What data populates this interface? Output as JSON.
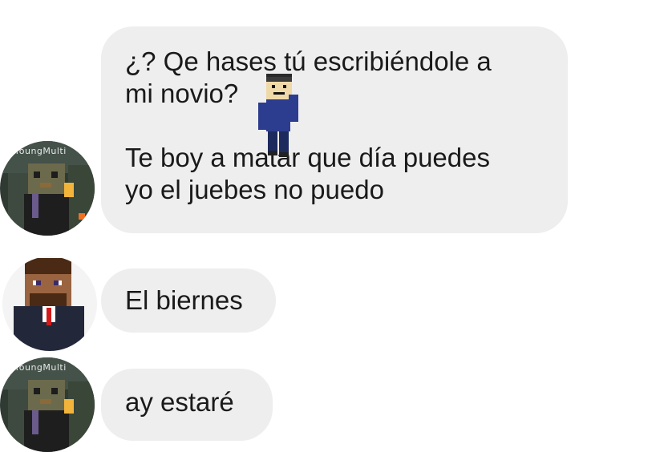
{
  "messages": [
    {
      "sender": "other",
      "lines_a": [
        "¿? Qe hases tú escribiéndole a",
        "mi novio?"
      ],
      "lines_b": [
        "Te boy a matar que día puedes",
        "yo el juebes no puedo"
      ],
      "sticker": "minecraft-character-sticker"
    },
    {
      "sender": "me",
      "text": "El biernes"
    },
    {
      "sender": "other",
      "text": "ay estaré"
    }
  ],
  "avatars": {
    "other": {
      "caption": "YoungMulti",
      "icon": "minecraft-skin-avatar"
    },
    "me": {
      "icon": "minecraft-suit-avatar"
    }
  },
  "colors": {
    "bubble": "#eeeeef",
    "text": "#1a1a1a"
  }
}
